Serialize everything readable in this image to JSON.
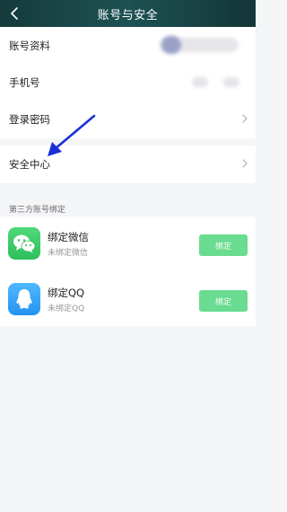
{
  "header": {
    "title": "账号与安全",
    "back_icon": "chevron-left-icon"
  },
  "account_section": {
    "items": [
      {
        "label": "账号资料",
        "value_hidden": true
      },
      {
        "label": "手机号",
        "value_hidden": true
      },
      {
        "label": "登录密码",
        "chevron_icon": "chevron-right-icon"
      }
    ]
  },
  "security_section": {
    "label": "安全中心",
    "chevron_icon": "chevron-right-icon"
  },
  "third_party": {
    "header": "第三方账号绑定",
    "items": [
      {
        "title": "绑定微信",
        "subtitle": "未绑定微信",
        "button": "绑定",
        "icon": "wechat-icon"
      },
      {
        "title": "绑定QQ",
        "subtitle": "未绑定QQ",
        "button": "绑定",
        "icon": "qq-icon"
      }
    ]
  },
  "colors": {
    "header_bg": "#1d5252",
    "accent_green": "#69dc90",
    "page_bg": "#f4f5f7",
    "annotation_arrow": "#1b2fd6"
  }
}
